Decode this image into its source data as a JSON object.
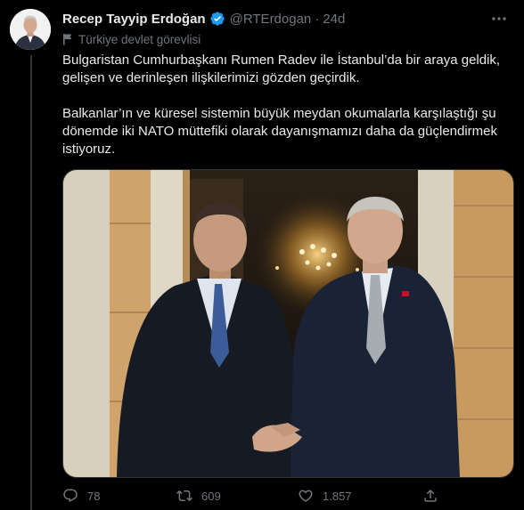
{
  "tweet": {
    "author_name": "Recep Tayyip Erdoğan",
    "handle": "@RTErdogan",
    "separator": "·",
    "time": "24d",
    "label": "Türkiye devlet görevlisi",
    "paragraphs": [
      "Bulgaristan Cumhurbaşkanı Rumen Radev ile İstanbul’da bir araya geldik, gelişen ve derinleşen ilişkilerimizi gözden geçirdik.",
      "Balkanlar’ın ve küresel sistemin büyük meydan okumalarla karşılaştığı şu dönemde iki NATO müttefiki olarak dayanışmamızı daha da güçlendirmek istiyoruz."
    ],
    "stats": {
      "replies": "78",
      "retweets": "609",
      "likes": "1.857"
    }
  },
  "icons": {
    "verified": "verified-badge-icon",
    "label": "flag-icon",
    "more": "more-icon",
    "reply": "reply-icon",
    "retweet": "retweet-icon",
    "like": "heart-icon",
    "share": "share-icon"
  },
  "colors": {
    "background": "#000000",
    "text": "#e7e9ea",
    "secondary": "#71767b",
    "verified": "#1d9bf0"
  }
}
